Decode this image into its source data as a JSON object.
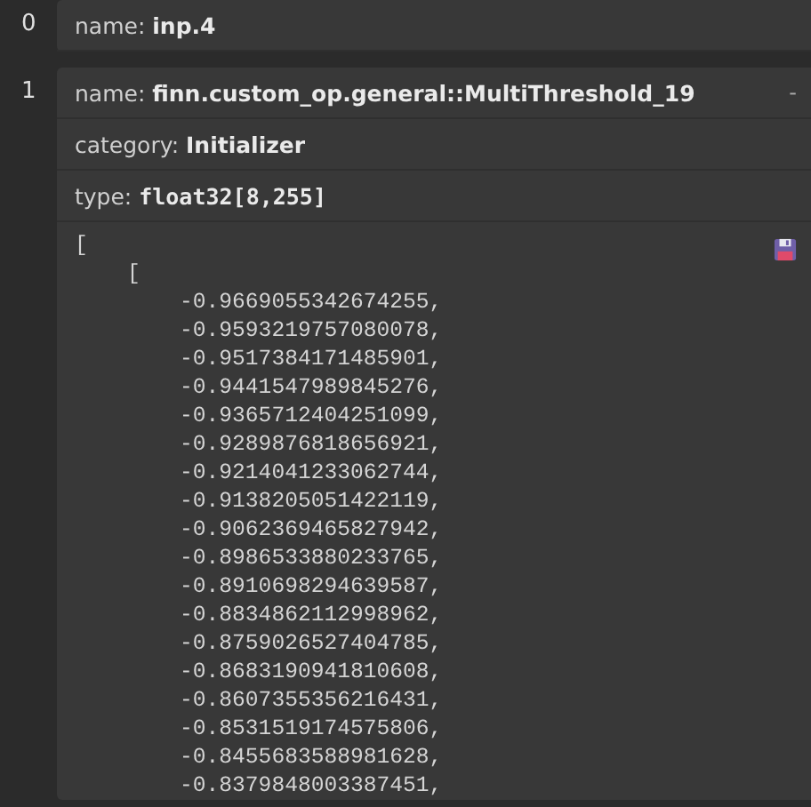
{
  "items": [
    {
      "index": "0",
      "fields": [
        {
          "kind": "text",
          "label": "name:",
          "value": "inp.4"
        }
      ]
    },
    {
      "index": "1",
      "toggle": "-",
      "fields": [
        {
          "kind": "text",
          "label": "name:",
          "value": "finn.custom_op.general::MultiThreshold_19"
        },
        {
          "kind": "text",
          "label": "category:",
          "value": "Initializer"
        },
        {
          "kind": "code",
          "label": "type:",
          "value": "float32[8,255]"
        }
      ],
      "value_lines": [
        "[",
        "    [",
        "        -0.9669055342674255,",
        "        -0.9593219757080078,",
        "        -0.9517384171485901,",
        "        -0.9441547989845276,",
        "        -0.9365712404251099,",
        "        -0.9289876818656921,",
        "        -0.9214041233062744,",
        "        -0.9138205051422119,",
        "        -0.9062369465827942,",
        "        -0.8986533880233765,",
        "        -0.8910698294639587,",
        "        -0.8834862112998962,",
        "        -0.8759026527404785,",
        "        -0.8683190941810608,",
        "        -0.8607355356216431,",
        "        -0.8531519174575806,",
        "        -0.8455683588981628,",
        "        -0.8379848003387451,"
      ]
    }
  ]
}
